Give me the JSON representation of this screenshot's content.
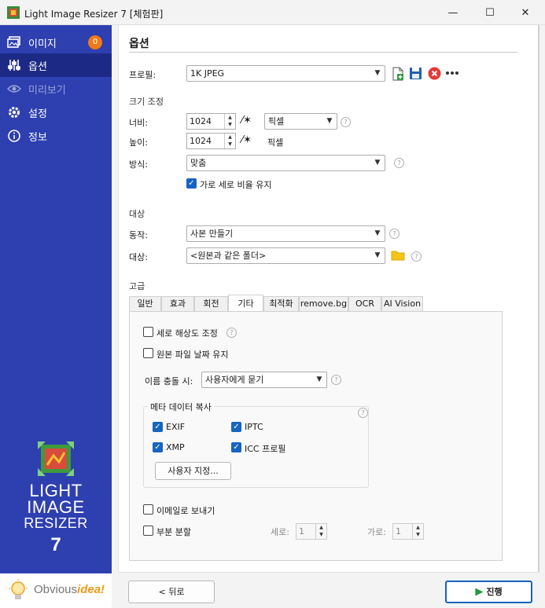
{
  "window": {
    "title": "Light Image Resizer 7  [체험판]",
    "minimize": "—",
    "maximize": "☐",
    "close": "✕"
  },
  "sidebar": {
    "items": [
      {
        "label": "이미지",
        "icon": "images-icon",
        "badge": "0"
      },
      {
        "label": "옵션",
        "icon": "sliders-icon",
        "active": true
      },
      {
        "label": "미리보기",
        "icon": "eye-icon",
        "disabled": true
      },
      {
        "label": "설정",
        "icon": "gear-icon"
      },
      {
        "label": "정보",
        "icon": "info-icon"
      }
    ],
    "logo": {
      "line1": "LIGHT",
      "line2": "IMAGE",
      "line3": "RESIZER",
      "version": "7"
    },
    "footer": {
      "brand_plain": "Obvious",
      "brand_accent": "idea!"
    }
  },
  "main": {
    "heading": "옵션",
    "profile": {
      "label": "프로필:",
      "value": "1K JPEG"
    },
    "resize": {
      "section": "크기 조정",
      "width_label": "너비:",
      "width_value": "1024",
      "width_unit": "픽셀",
      "height_label": "높이:",
      "height_value": "1024",
      "height_unit": "픽셀",
      "method_label": "방식:",
      "method_value": "맞춤",
      "keep_ratio": "가로 세로 비율 유지"
    },
    "target": {
      "section": "대상",
      "action_label": "동작:",
      "action_value": "사본 만들기",
      "dest_label": "대상:",
      "dest_value": "<원본과 같은 폴더>"
    },
    "advanced": {
      "section": "고급",
      "tabs": [
        "일반",
        "효과",
        "회전",
        "기타",
        "최적화",
        "remove.bg",
        "OCR",
        "AI Vision"
      ],
      "active_tab": "기타",
      "vertical_res": "세로 해상도 조정",
      "keep_date": "원본 파일 날짜 유지",
      "conflict_label": "이름 충돌 시:",
      "conflict_value": "사용자에게 묻기",
      "meta": {
        "title": "메타 데이터 복사",
        "exif": "EXIF",
        "iptc": "IPTC",
        "xmp": "XMP",
        "icc": "ICC 프로필",
        "custom_btn": "사용자 지정..."
      },
      "email": "이메일로 보내기",
      "split": "부분 분할",
      "split_rows_label": "세로:",
      "split_rows": "1",
      "split_cols_label": "가로:",
      "split_cols": "1"
    }
  },
  "buttons": {
    "back": "< 뒤로",
    "run": "진행"
  },
  "colors": {
    "sidebar": "#2e3fb0",
    "sidebar_active": "#1d2a85",
    "badge": "#f07a17",
    "check": "#1664c0",
    "folder": "#f5c518"
  }
}
